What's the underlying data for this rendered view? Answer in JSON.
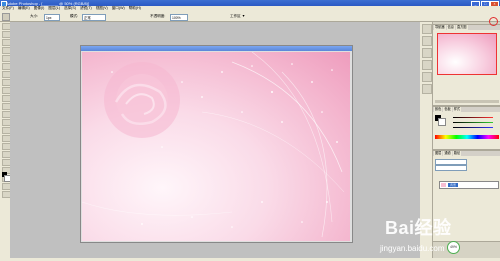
{
  "window": {
    "title": "Adobe Photoshop - [_______ @ 50% (RGB/8)]",
    "minimize": "_",
    "maximize": "□",
    "close": "×"
  },
  "menu": [
    "文件(F)",
    "编辑(E)",
    "图像(I)",
    "图层(L)",
    "选择(S)",
    "滤镜(T)",
    "视图(V)",
    "窗口(W)",
    "帮助(H)"
  ],
  "options": {
    "size_label": "大小:",
    "size_value": "1px",
    "mode_label": "模式:",
    "mode_value": "正常",
    "opacity_label": "不透明度:",
    "opacity_value": "100%",
    "workspace": "工作区 ▼"
  },
  "panels": {
    "navigator_tabs": [
      "导航器",
      "信息",
      "直方图"
    ],
    "color_tabs": [
      "颜色",
      "色板",
      "样式"
    ],
    "layers_tabs": [
      "图层",
      "通道",
      "路径"
    ],
    "layer_name": "背景"
  },
  "status": {
    "zoom_badge": "49%"
  },
  "watermark": {
    "main": "Bai经验",
    "sub": "jingyan.baidu.com"
  },
  "colors": {
    "accent": "#ef9dbd",
    "title_bar": "#2a58c4",
    "panel_bg": "#ece9d8"
  }
}
